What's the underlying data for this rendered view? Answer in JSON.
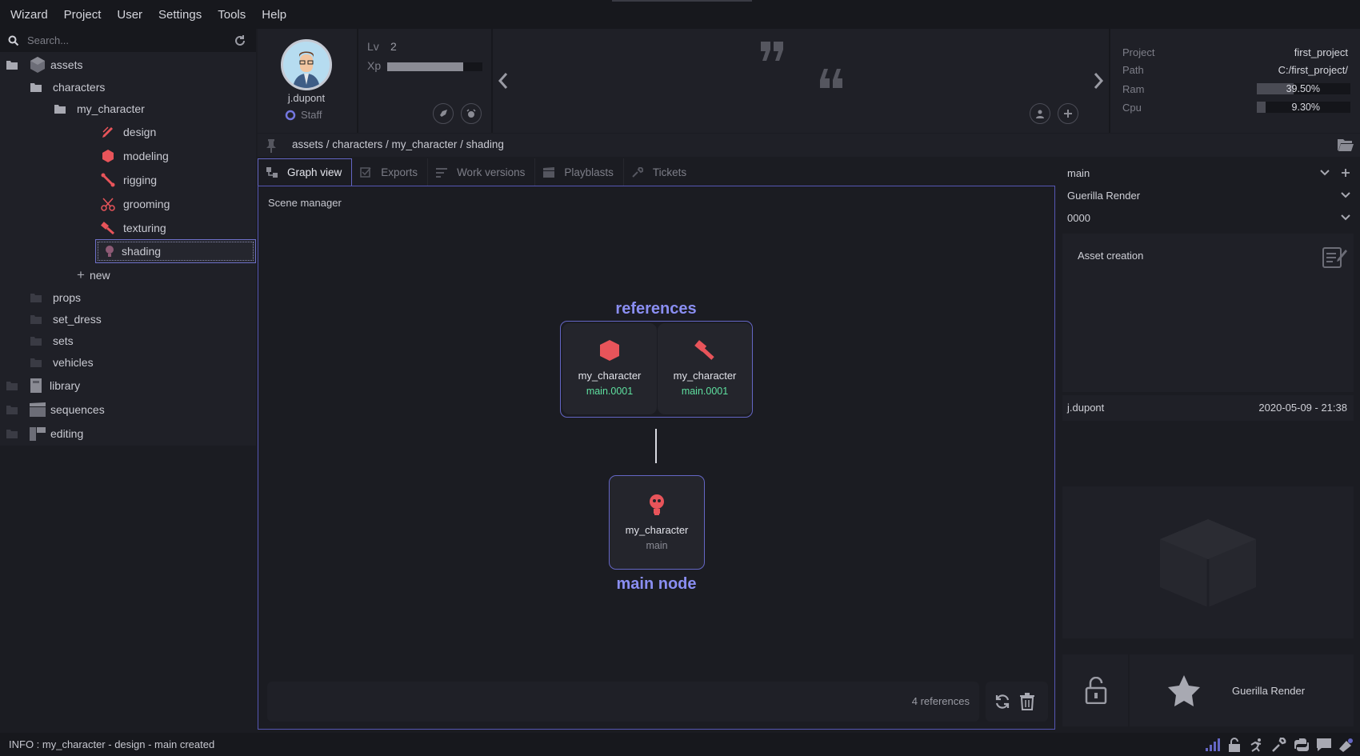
{
  "menu": [
    "Wizard",
    "Project",
    "User",
    "Settings",
    "Tools",
    "Help"
  ],
  "search": {
    "placeholder": "Search..."
  },
  "tree": {
    "assets": "assets",
    "characters": "characters",
    "my_character": "my_character",
    "stages": [
      "design",
      "modeling",
      "rigging",
      "grooming",
      "texturing",
      "shading"
    ],
    "new": "new",
    "categories": [
      "props",
      "set_dress",
      "sets",
      "vehicles"
    ],
    "roots": [
      "library",
      "sequences",
      "editing"
    ]
  },
  "user": {
    "name": "j.dupont",
    "role": "Staff",
    "lv_label": "Lv",
    "level": "2",
    "xp_label": "Xp",
    "xp_progress": 0.8
  },
  "project_info": {
    "project_label": "Project",
    "project": "first_project",
    "path_label": "Path",
    "path": "C:/first_project/",
    "ram_label": "Ram",
    "ram": "39.50%",
    "ram_fraction": 0.395,
    "cpu_label": "Cpu",
    "cpu": "9.30%",
    "cpu_fraction": 0.093
  },
  "breadcrumb": "assets / characters / my_character / shading",
  "tabs": [
    "Graph view",
    "Exports",
    "Work versions",
    "Playblasts",
    "Tickets"
  ],
  "graph": {
    "section_label": "Scene manager",
    "references_title": "references",
    "references": [
      {
        "name": "my_character",
        "version": "main.0001",
        "icon": "modeling-cube-icon"
      },
      {
        "name": "my_character",
        "version": "main.0001",
        "icon": "texturing-brush-icon"
      }
    ],
    "main_node": {
      "name": "my_character",
      "version": "main",
      "icon": "shading-bulb-icon"
    },
    "main_title": "main node",
    "references_count": "4 references"
  },
  "right": {
    "variant": "main",
    "renderer": "Guerilla Render",
    "version": "0000",
    "comment": "Asset creation",
    "author": "j.dupont",
    "date": "2020-05-09 - 21:38",
    "render_button": "Guerilla Render"
  },
  "status": "INFO : my_character - design - main created",
  "colors": {
    "accent": "#8a8ef2",
    "node_version": "#5fe0a0",
    "stage_icon": "#e8545a",
    "background": "#1b1c22"
  }
}
